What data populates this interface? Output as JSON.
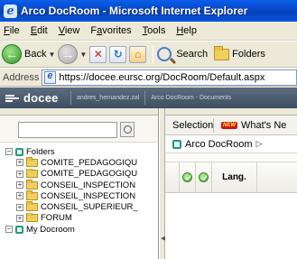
{
  "window": {
    "title": "Arco DocRoom - Microsoft Internet Explorer",
    "icon": "ie-logo-icon"
  },
  "menu": {
    "items": [
      {
        "label": "File",
        "key": "F",
        "rest": "ile"
      },
      {
        "label": "Edit",
        "key": "E",
        "rest": "dit"
      },
      {
        "label": "View",
        "key": "V",
        "rest": "iew"
      },
      {
        "label": "Favorites",
        "key": "a",
        "pre": "F",
        "rest": "vorites"
      },
      {
        "label": "Tools",
        "key": "T",
        "rest": "ools"
      },
      {
        "label": "Help",
        "key": "H",
        "rest": "elp"
      }
    ]
  },
  "toolbar": {
    "back_label": "Back",
    "search_label": "Search",
    "folders_label": "Folders"
  },
  "address": {
    "label": "Address",
    "url": "https://docee.eursc.org/DocRoom/Default.aspx"
  },
  "app_header": {
    "brand": "docee",
    "user": "andres_hernandez.zal",
    "section": "Arco DocRoom - Documents"
  },
  "left_panel": {
    "tree": [
      {
        "label": "Folders",
        "level": 0,
        "expander": "−",
        "kind": "root"
      },
      {
        "label": "COMITE_PEDAGOGIQU",
        "level": 1,
        "expander": "+",
        "kind": "folder"
      },
      {
        "label": "COMITE_PEDAGOGIQU",
        "level": 1,
        "expander": "+",
        "kind": "folder"
      },
      {
        "label": "CONSEIL_INSPECTION",
        "level": 1,
        "expander": "+",
        "kind": "folder"
      },
      {
        "label": "CONSEIL_INSPECTION",
        "level": 1,
        "expander": "+",
        "kind": "folder"
      },
      {
        "label": "CONSEIL_SUPERIEUR_",
        "level": 1,
        "expander": "+",
        "kind": "folder"
      },
      {
        "label": "FORUM",
        "level": 1,
        "expander": "+",
        "kind": "folder"
      },
      {
        "label": "My Docroom",
        "level": 0,
        "expander": "−",
        "kind": "root"
      }
    ]
  },
  "right_panel": {
    "tab_selection": "Selection",
    "new_badge": "NEW",
    "tab_whats_new": "What's Ne",
    "breadcrumb": "Arco DocRoom",
    "grid_header_lang": "Lang."
  },
  "colors": {
    "titlebar": "#0a5fe8",
    "app_header": "#4a5a6c",
    "root_icon": "#1f9d74",
    "new_badge": "#d21414"
  }
}
